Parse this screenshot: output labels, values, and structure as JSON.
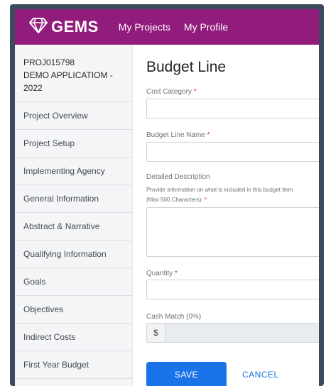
{
  "header": {
    "logo_text": "GEMS",
    "nav": [
      "My Projects",
      "My Profile"
    ]
  },
  "sidebar": {
    "project_lines": [
      "PROJ015798",
      "DEMO APPLICATIOM -",
      "2022"
    ],
    "items": [
      {
        "label": "Project Overview"
      },
      {
        "label": "Project Setup"
      },
      {
        "label": "Implementing Agency"
      },
      {
        "label": "General Information"
      },
      {
        "label": "Abstract & Narrative"
      },
      {
        "label": "Qualifying Information"
      },
      {
        "label": "Goals"
      },
      {
        "label": "Objectives"
      },
      {
        "label": "Indirect Costs"
      },
      {
        "label": "First Year Budget"
      }
    ]
  },
  "form": {
    "title": "Budget Line",
    "cost_category_label": "Cost Category",
    "budget_line_name_label": "Budget Line Name",
    "description_label": "Detailed Description",
    "description_help_1": "Provide information on what is included in this budget item",
    "description_help_2": "(Max 500 Characters).",
    "quantity_label": "Quantity",
    "cash_match_label": "Cash Match (0%)",
    "currency_symbol": "$",
    "required_mark": "*",
    "save_label": "SAVE",
    "cancel_label": "CANCEL"
  },
  "colors": {
    "header_bg": "#921c7c",
    "primary": "#1a73e8",
    "required": "#d32f2f"
  }
}
